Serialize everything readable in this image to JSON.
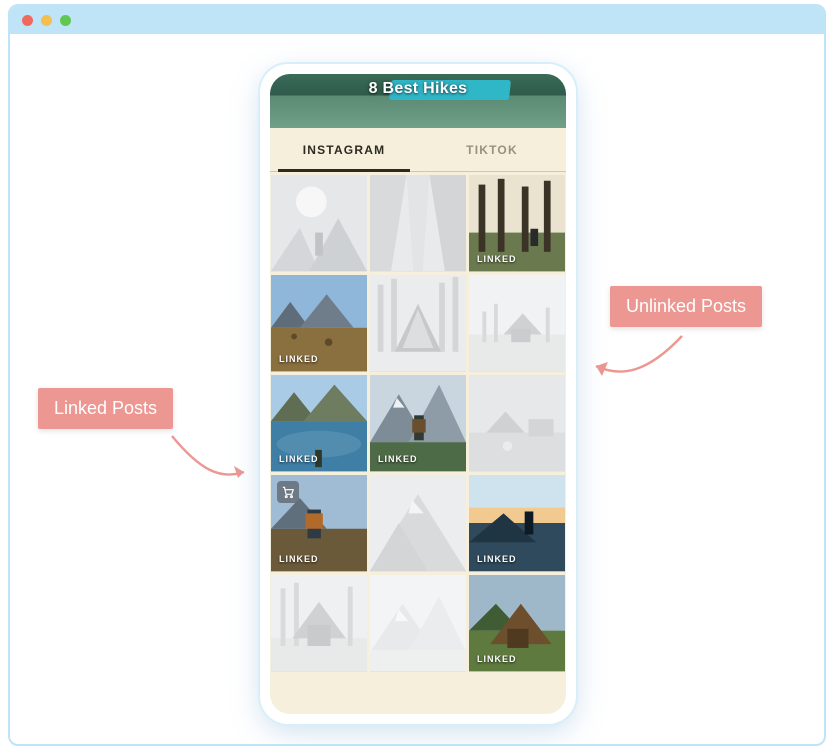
{
  "browser": {
    "dots": [
      "red",
      "yellow",
      "green"
    ]
  },
  "hero": {
    "title": "8 Best Hikes"
  },
  "tabs": [
    {
      "id": "instagram",
      "label": "INSTAGRAM",
      "active": true
    },
    {
      "id": "tiktok",
      "label": "TIKTOK",
      "active": false
    }
  ],
  "linked_badge_text": "LINKED",
  "posts": [
    {
      "linked": false,
      "scene": "sun-hiker",
      "cart": false
    },
    {
      "linked": false,
      "scene": "canyon",
      "cart": false
    },
    {
      "linked": true,
      "scene": "forest",
      "cart": false
    },
    {
      "linked": true,
      "scene": "plateau",
      "cart": false
    },
    {
      "linked": false,
      "scene": "aframe",
      "cart": false
    },
    {
      "linked": false,
      "scene": "cabin-fog",
      "cart": false
    },
    {
      "linked": true,
      "scene": "lake",
      "cart": false
    },
    {
      "linked": true,
      "scene": "hiker-mtn",
      "cart": false
    },
    {
      "linked": false,
      "scene": "camp",
      "cart": false
    },
    {
      "linked": true,
      "scene": "backpack",
      "cart": true
    },
    {
      "linked": false,
      "scene": "ridge",
      "cart": false
    },
    {
      "linked": true,
      "scene": "sunset",
      "cart": false
    },
    {
      "linked": false,
      "scene": "barn",
      "cart": false
    },
    {
      "linked": false,
      "scene": "snow",
      "cart": false
    },
    {
      "linked": true,
      "scene": "hut",
      "cart": false
    }
  ],
  "annotations": {
    "linked": {
      "label": "Linked Posts"
    },
    "unlinked": {
      "label": "Unlinked Posts"
    }
  },
  "colors": {
    "window_border": "#bfe3f7",
    "callout_bg": "#ec9791",
    "screen_bg": "#f5efdc",
    "tab_active": "#2d2a22"
  }
}
